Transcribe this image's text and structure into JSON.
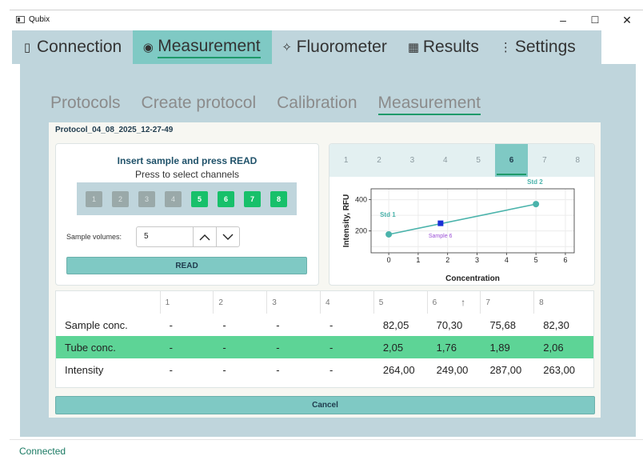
{
  "window": {
    "title": "Qubix",
    "minimize": "–",
    "maximize": "☐",
    "close": "✕"
  },
  "main_tabs": [
    {
      "label": "Connection",
      "icon": "plug-icon",
      "glyph": "▯"
    },
    {
      "label": "Measurement",
      "icon": "target-icon",
      "glyph": "◉"
    },
    {
      "label": "Fluorometer",
      "icon": "sparkle-icon",
      "glyph": "✧"
    },
    {
      "label": "Results",
      "icon": "results-icon",
      "glyph": "▦"
    },
    {
      "label": "Settings",
      "icon": "more-vertical-icon",
      "glyph": "⋮"
    }
  ],
  "main_tab_active": "Measurement",
  "sub_tabs": [
    "Protocols",
    "Create protocol",
    "Calibration",
    "Measurement"
  ],
  "sub_tab_active": "Measurement",
  "protocol_name": "Protocol_04_08_2025_12-27-49",
  "read_panel": {
    "title": "Insert sample and press READ",
    "subtitle": "Press to select channels",
    "channels": [
      {
        "label": "1",
        "selected": false
      },
      {
        "label": "2",
        "selected": false
      },
      {
        "label": "3",
        "selected": false
      },
      {
        "label": "4",
        "selected": false
      },
      {
        "label": "5",
        "selected": true
      },
      {
        "label": "6",
        "selected": true
      },
      {
        "label": "7",
        "selected": true
      },
      {
        "label": "8",
        "selected": true
      }
    ],
    "volume_label": "Sample volumes:",
    "volume_value": "5",
    "read_button": "READ"
  },
  "chart_tabs": [
    "1",
    "2",
    "3",
    "4",
    "5",
    "6",
    "7",
    "8"
  ],
  "chart_tab_active": "6",
  "chart_data": {
    "type": "line",
    "title": "",
    "xlabel": "Concentration",
    "ylabel": "Intensity, RFU",
    "xlim": [
      -0.6,
      6.3
    ],
    "ylim": [
      60,
      470
    ],
    "x_ticks": [
      "0",
      "1",
      "2",
      "3",
      "4",
      "5",
      "6"
    ],
    "y_ticks": [
      "200",
      "400"
    ],
    "grid": true,
    "series": [
      {
        "name": "",
        "x": [
          0,
          5
        ],
        "y": [
          178,
          372
        ],
        "color": "#4ab3ab",
        "point_labels": [
          "Std 1",
          "Std 2"
        ]
      }
    ],
    "sample_point": {
      "label": "Sample 6",
      "x": 1.76,
      "y": 249,
      "color": "#1a2fd6"
    }
  },
  "table": {
    "headers": [
      "",
      "1",
      "2",
      "3",
      "4",
      "5",
      "6",
      "7",
      "8"
    ],
    "rows": [
      {
        "label": "Sample conc.",
        "values": [
          "-",
          "-",
          "-",
          "-",
          "82,05",
          "70,30",
          "75,68",
          "82,30"
        ]
      },
      {
        "label": "Tube conc.",
        "values": [
          "-",
          "-",
          "-",
          "-",
          "2,05",
          "1,76",
          "1,89",
          "2,06"
        ]
      },
      {
        "label": "Intensity",
        "values": [
          "-",
          "-",
          "-",
          "-",
          "264,00",
          "249,00",
          "287,00",
          "263,00"
        ]
      }
    ],
    "sort_glyph": "↑"
  },
  "cancel_button": "Cancel",
  "status": "Connected",
  "colors": {
    "accent": "#7fc9c4",
    "selected_channel": "#17c06a",
    "highlight_row": "#5dd496",
    "panel_bg": "#bfd5dc",
    "underline": "#1e9a6a"
  }
}
